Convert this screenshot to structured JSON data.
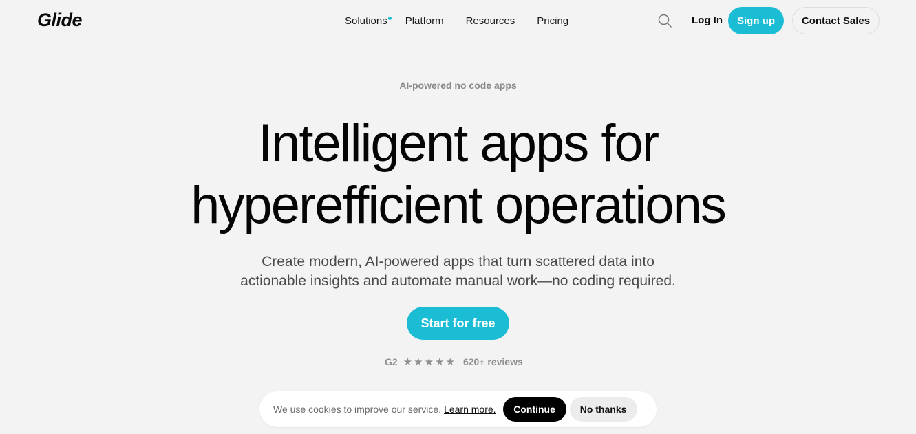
{
  "brand": {
    "logo": "Glide",
    "accent_color": "#1bbdd4"
  },
  "nav": {
    "links": [
      {
        "label": "Solutions",
        "has_dot": true
      },
      {
        "label": "Platform"
      },
      {
        "label": "Resources"
      },
      {
        "label": "Pricing"
      }
    ],
    "search_icon": "search-icon",
    "login": "Log In",
    "signup": "Sign up",
    "contact": "Contact Sales"
  },
  "hero": {
    "eyebrow": "AI-powered no code apps",
    "title_line1": "Intelligent apps for",
    "title_line2": "hyperefficient operations",
    "subtitle_line1": "Create modern, AI-powered apps that turn scattered data into",
    "subtitle_line2": "actionable insights and automate manual work—no coding required.",
    "cta": "Start for free"
  },
  "reviews": {
    "source": "G2",
    "rating_stars": 5,
    "star_glyph": "★",
    "count": "620+ reviews"
  },
  "cookie_banner": {
    "text": "We use cookies to improve our service.",
    "learn_more": "Learn more.",
    "continue": "Continue",
    "no_thanks": "No thanks"
  }
}
